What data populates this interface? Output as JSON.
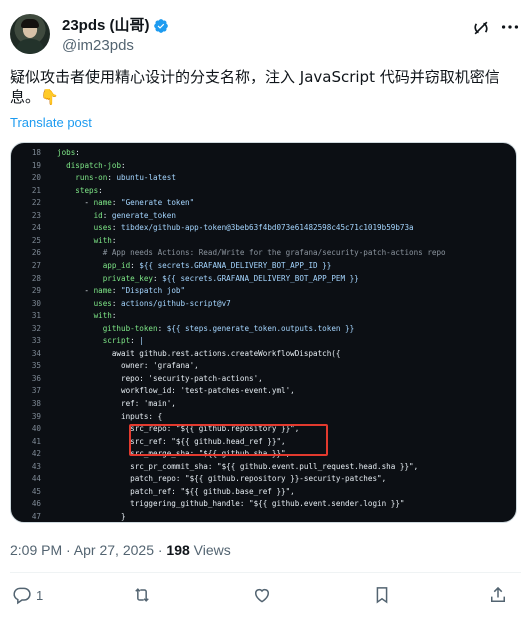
{
  "author": {
    "display_name": "23pds (山哥)",
    "handle": "@im23pds"
  },
  "tweet": {
    "text": "疑似攻击者使用精心设计的分支名称，注入 JavaScript 代码并窃取机密信息。👇",
    "translate_label": "Translate post"
  },
  "code": {
    "lines": [
      {
        "n": "18",
        "t": "jobs:"
      },
      {
        "n": "19",
        "t": "  dispatch-job:"
      },
      {
        "n": "20",
        "t": "    runs-on: ubuntu-latest"
      },
      {
        "n": "21",
        "t": "    steps:"
      },
      {
        "n": "22",
        "t": "      - name: \"Generate token\""
      },
      {
        "n": "23",
        "t": "        id: generate_token"
      },
      {
        "n": "24",
        "t": "        uses: tibdex/github-app-token@3beb63f4bd073e61482598c45c71c1019b59b73a"
      },
      {
        "n": "25",
        "t": "        with:"
      },
      {
        "n": "26",
        "t": "          # App needs Actions: Read/Write for the grafana/security-patch-actions repo"
      },
      {
        "n": "27",
        "t": "          app_id: ${{ secrets.GRAFANA_DELIVERY_BOT_APP_ID }}"
      },
      {
        "n": "28",
        "t": "          private_key: ${{ secrets.GRAFANA_DELIVERY_BOT_APP_PEM }}"
      },
      {
        "n": "29",
        "t": "      - name: \"Dispatch job\""
      },
      {
        "n": "30",
        "t": "        uses: actions/github-script@v7"
      },
      {
        "n": "31",
        "t": "        with:"
      },
      {
        "n": "32",
        "t": "          github-token: ${{ steps.generate_token.outputs.token }}"
      },
      {
        "n": "33",
        "t": "          script: |"
      },
      {
        "n": "34",
        "t": "            await github.rest.actions.createWorkflowDispatch({"
      },
      {
        "n": "35",
        "t": "              owner: 'grafana',"
      },
      {
        "n": "36",
        "t": "              repo: 'security-patch-actions',"
      },
      {
        "n": "37",
        "t": "              workflow_id: 'test-patches-event.yml',"
      },
      {
        "n": "38",
        "t": "              ref: 'main',"
      },
      {
        "n": "39",
        "t": "              inputs: {"
      },
      {
        "n": "40",
        "t": "                src_repo: \"${{ github.repository }}\","
      },
      {
        "n": "41",
        "t": "                src_ref: \"${{ github.head_ref }}\","
      },
      {
        "n": "42",
        "t": "                src_merge_sha: \"${{ github.sha }}\","
      },
      {
        "n": "43",
        "t": "                src_pr_commit_sha: \"${{ github.event.pull_request.head.sha }}\","
      },
      {
        "n": "44",
        "t": "                patch_repo: \"${{ github.repository }}-security-patches\","
      },
      {
        "n": "45",
        "t": "                patch_ref: \"${{ github.base_ref }}\","
      },
      {
        "n": "46",
        "t": "                triggering_github_handle: \"${{ github.event.sender.login }}\""
      },
      {
        "n": "47",
        "t": "              }"
      }
    ]
  },
  "meta": {
    "timestamp": "2:09 PM · Apr 27, 2025 · ",
    "views_count": "198",
    "views_label": " Views"
  },
  "actions": {
    "reply_count": "1",
    "retweet_count": "",
    "like_count": ""
  },
  "colors": {
    "link": "#1d9bf0",
    "highlight_border": "#e33a2e",
    "code_bg": "#0c0f14"
  }
}
